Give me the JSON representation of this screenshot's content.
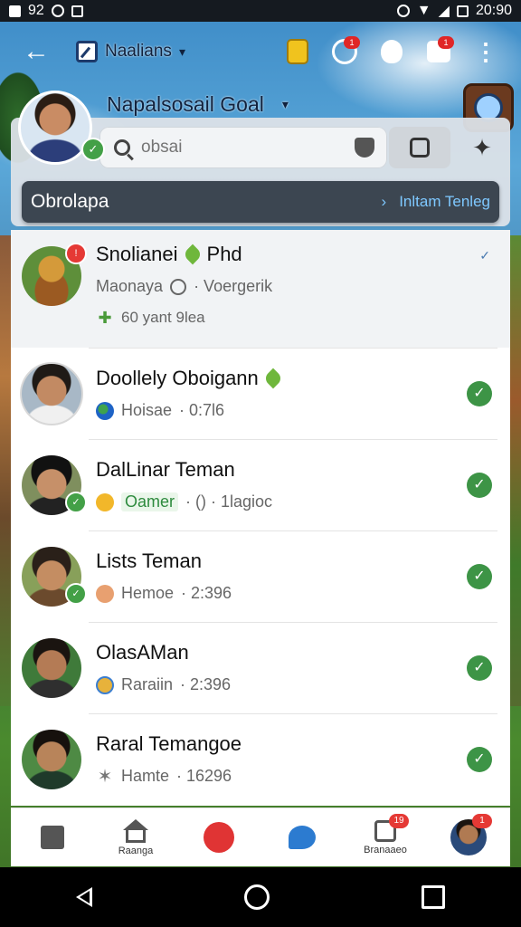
{
  "status_bar": {
    "left_text": "92",
    "time": "20:90"
  },
  "app_bar": {
    "title": "Naalians",
    "caret": "▾",
    "notif_1": "1",
    "notif_2": "1"
  },
  "profile": {
    "name": "Napalsosail Goal",
    "caret": "▾"
  },
  "search": {
    "placeholder": "obsai",
    "value": ""
  },
  "section": {
    "title": "Obrolapa",
    "link_arrow": "›",
    "link_label": "Inltam Tenleg"
  },
  "conversations": [
    {
      "name": "Snolianei",
      "name_suffix": "Phd",
      "sub": "Maonaya",
      "sub_suffix": "· Voergerik",
      "extra": "60 yant 9lea",
      "badge": "!",
      "featured": true
    },
    {
      "name": "Doollely Oboigann",
      "status": "Hoisae",
      "time": "· 0:7l6"
    },
    {
      "name": "DalLinar Teman",
      "status": "Oamer",
      "time": "· () · 1lagioc"
    },
    {
      "name": "Lists Teman",
      "status": "Hemoe",
      "time": "· 2:396"
    },
    {
      "name": "OlasAMan",
      "status": "Raraiin",
      "time": "· 2:396"
    },
    {
      "name": "Raral Temangoe",
      "status": "Hamte",
      "time": "· 16296"
    }
  ],
  "bottom_nav": {
    "home_label": "Raanga",
    "messages_label": "Branaaeo",
    "messages_badge": "19",
    "profile_badge": "1"
  },
  "colors": {
    "accent_green": "#3d9446",
    "badge_red": "#e53935",
    "section_bg": "#3c4651",
    "link_blue": "#7ec8ff"
  }
}
